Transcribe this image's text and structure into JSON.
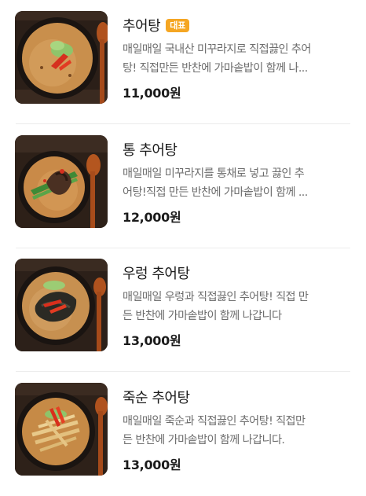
{
  "menu": {
    "items": [
      {
        "name": "추어탕",
        "badge": "대표",
        "desc_line1": "매일매일 국내산 미꾸라지로 직접끓인 추어",
        "desc_line2": "탕! 직접만든 반찬에 가마솥밥이 함께 나...",
        "price": "11,000원",
        "image": "chueotang-bowl-image"
      },
      {
        "name": "통 추어탕",
        "desc_line1": "매일매일 미꾸라지를 통채로 넣고 끓인 추",
        "desc_line2": "어탕!직접 만든 반찬에 가마솥밥이 함께 ...",
        "price": "12,000원",
        "image": "whole-loach-soup-image"
      },
      {
        "name": "우렁 추어탕",
        "desc_line1": "매일매일 우렁과 직접끓인 추어탕! 직접 만",
        "desc_line2": "든 반찬에 가마솥밥이 함께 나갑니다",
        "price": "13,000원",
        "image": "snail-loach-soup-image"
      },
      {
        "name": "죽순 추어탕",
        "desc_line1": "매일매일 죽순과 직접끓인 추어탕! 직접만",
        "desc_line2": "든 반찬에 가마솥밥이 함께 나갑니다.",
        "price": "13,000원",
        "image": "bamboo-shoot-loach-soup-image"
      }
    ]
  },
  "colors": {
    "badge": "#f5a623",
    "name": "#1b1b1b",
    "desc": "#6d6d6d",
    "divider": "#ececec"
  }
}
